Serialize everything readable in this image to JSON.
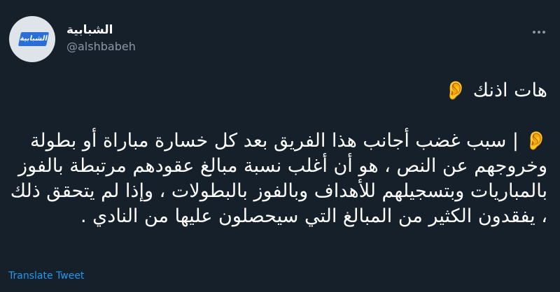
{
  "author": {
    "display_name": "الشبابية",
    "handle": "@alshbabeh",
    "avatar_text": "الشبابية"
  },
  "tweet": {
    "line1_text": "هات اذنك",
    "line1_icon": "ear-emoji",
    "line1_emoji": "👂",
    "line2_icon": "ear-emoji",
    "line2_emoji": "👂",
    "line2_text": "| سبب غضب أجانب هذا الفريق بعد كل خسارة مباراة أو بطولة وخروجهم عن النص ، هو أن أغلب نسبة مبالغ عقودهم مرتبطة بالفوز بالمباريات وبتسجيلهم للأهداف وبالفوز بالبطولات ، وإذا لم يتحقق ذلك ، يفقدون الكثير من المبالغ التي سيحصلون عليها من النادي ."
  },
  "actions": {
    "translate_label": "Translate Tweet",
    "more_icon": "more-horizontal-icon"
  },
  "colors": {
    "background": "#15202b",
    "text": "#ffffff",
    "muted": "#8b98a5",
    "link": "#1d9bf0"
  }
}
